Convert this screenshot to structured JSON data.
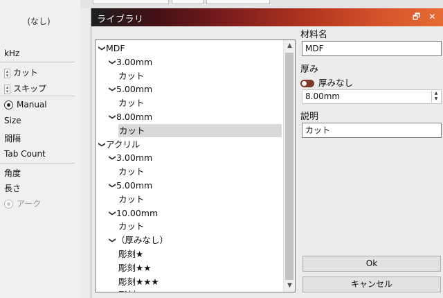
{
  "left_panel": {
    "none_label": "(なし)",
    "unit_label": "kHz",
    "cut_label": "カット",
    "skip_label": "スキップ",
    "manual_label": "Manual",
    "size_label": "Size",
    "interval_label": "間隔",
    "tab_count_label": "Tab Count",
    "angle_label": "角度",
    "length_label": "長さ",
    "arc_label": "アーク"
  },
  "dialog": {
    "title": "ライブラリ",
    "restore_glyph": "🗗",
    "close_glyph": "✕"
  },
  "tree": {
    "items": [
      {
        "label": "MDF",
        "level": 0,
        "expanded": true
      },
      {
        "label": "3.00mm",
        "level": 1,
        "expanded": true
      },
      {
        "label": "カット",
        "level": 2
      },
      {
        "label": "5.00mm",
        "level": 1,
        "expanded": true
      },
      {
        "label": "カット",
        "level": 2
      },
      {
        "label": "8.00mm",
        "level": 1,
        "expanded": true
      },
      {
        "label": "カット",
        "level": 2,
        "selected": true
      },
      {
        "label": "アクリル",
        "level": 0,
        "expanded": true
      },
      {
        "label": "3.00mm",
        "level": 1,
        "expanded": true
      },
      {
        "label": "カット",
        "level": 2
      },
      {
        "label": "5.00mm",
        "level": 1,
        "expanded": true
      },
      {
        "label": "カット",
        "level": 2
      },
      {
        "label": "10.00mm",
        "level": 1,
        "expanded": true
      },
      {
        "label": "カット",
        "level": 2
      },
      {
        "label": "（厚みなし）",
        "level": 1,
        "expanded": true
      },
      {
        "label": "彫刻★",
        "level": 2
      },
      {
        "label": "彫刻★★",
        "level": 2
      },
      {
        "label": "彫刻★★★",
        "level": 2
      },
      {
        "label": "彫刻☆",
        "level": 2
      }
    ],
    "chevron_glyph": "❯",
    "scroll_up_glyph": "▲",
    "scroll_down_glyph": "▼"
  },
  "form": {
    "material_name_label": "材料名",
    "material_name_value": "MDF",
    "thickness_label": "厚み",
    "no_thickness_label": "厚みなし",
    "thickness_value": "8.00mm",
    "description_label": "説明",
    "description_value": "カット",
    "ok_label": "Ok",
    "cancel_label": "キャンセル"
  },
  "colors": {
    "title_gradient_start": "#1e1e1e",
    "title_gradient_end": "#e56c34",
    "toggle_accent": "#7c3a2a",
    "selection": "#d9d9d9"
  }
}
